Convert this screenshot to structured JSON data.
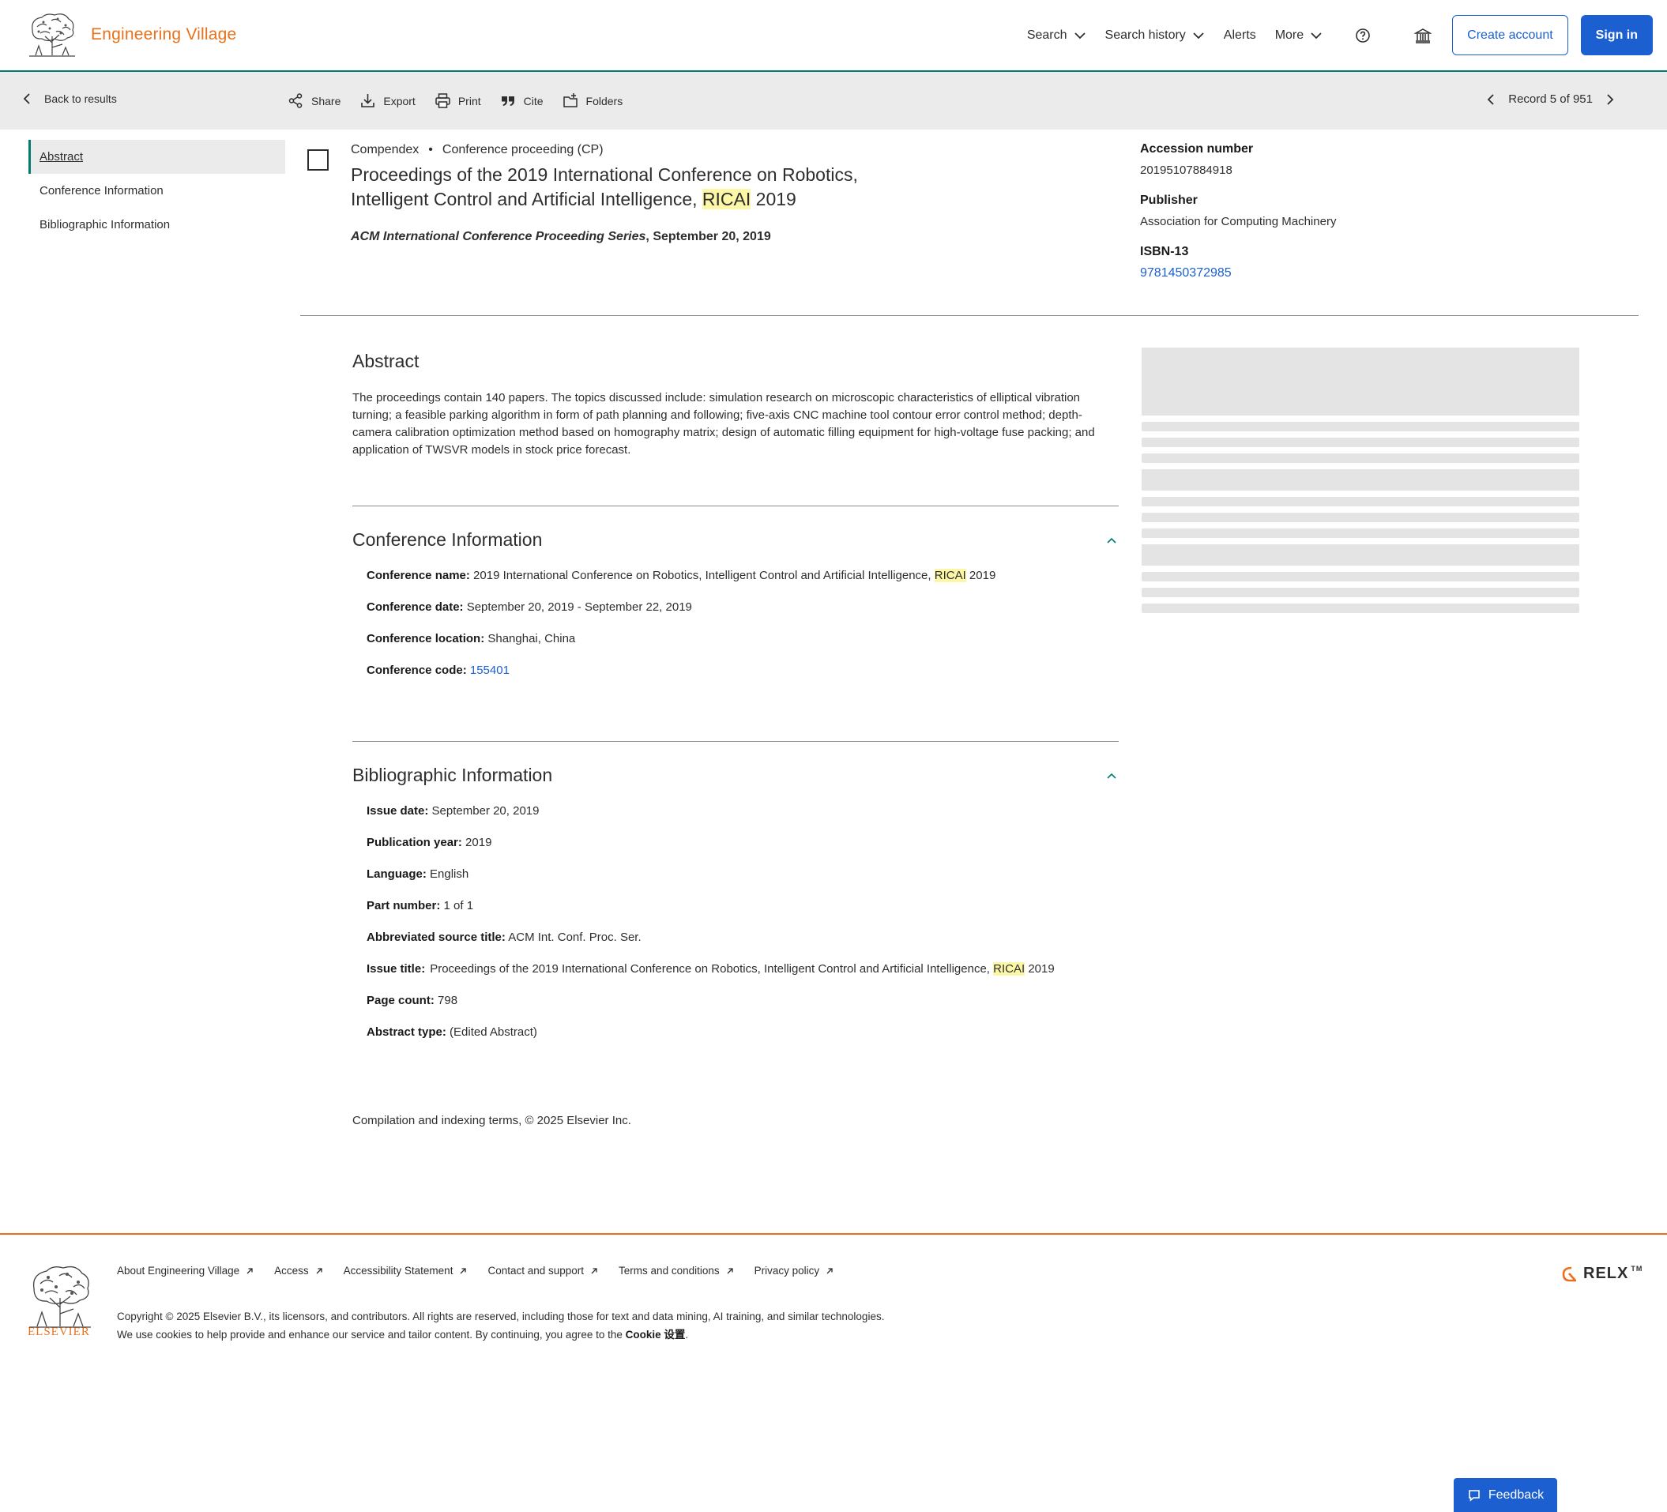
{
  "header": {
    "brand": "Engineering Village",
    "nav": {
      "search": "Search",
      "search_history": "Search history",
      "alerts": "Alerts",
      "more": "More"
    },
    "create_account": "Create account",
    "sign_in": "Sign in"
  },
  "toolbar": {
    "back": "Back to results",
    "share": "Share",
    "export": "Export",
    "print": "Print",
    "cite": "Cite",
    "folders": "Folders",
    "record": "Record 5 of 951"
  },
  "leftnav": {
    "items": [
      "Abstract",
      "Conference Information",
      "Bibliographic Information"
    ]
  },
  "record": {
    "database": "Compendex",
    "bullet": "•",
    "doc_type": "Conference proceeding (CP)",
    "title_part1": "Proceedings of the 2019 International Conference on Robotics, Intelligent Control and Artificial Intelligence, ",
    "title_highlight": "RICAI",
    "title_part2": " 2019",
    "source_series": "ACM International Conference Proceeding Series",
    "source_date": ", September 20, 2019"
  },
  "facts": {
    "accession_label": "Accession number",
    "accession_value": "20195107884918",
    "publisher_label": "Publisher",
    "publisher_value": "Association for Computing Machinery",
    "isbn_label": "ISBN-13",
    "isbn_value": "9781450372985"
  },
  "abstract": {
    "title": "Abstract",
    "text": "The proceedings contain 140 papers. The topics discussed include: simulation research on microscopic characteristics of elliptical vibration turning; a feasible parking algorithm in form of path planning and following; five-axis CNC machine tool contour error control method; depth-camera calibration optimization method based on homography matrix; design of automatic filling equipment for high-voltage fuse packing; and application of TWSVR models in stock price forecast."
  },
  "conference": {
    "title": "Conference Information",
    "name_label": "Conference name:",
    "name_value_part1": " 2019 International Conference on Robotics, Intelligent Control and Artificial Intelligence, ",
    "name_highlight": "RICAI",
    "name_value_part2": " 2019",
    "date_label": "Conference date:",
    "date_value": " September 20, 2019 - September 22, 2019",
    "location_label": "Conference location:",
    "location_value": " Shanghai, China",
    "code_label": "Conference code:",
    "code_value": "155401"
  },
  "biblio": {
    "title": "Bibliographic Information",
    "issue_date_label": "Issue date:",
    "issue_date_value": " September 20, 2019",
    "pub_year_label": "Publication year:",
    "pub_year_value": " 2019",
    "language_label": "Language:",
    "language_value": " English",
    "part_label": "Part number:",
    "part_value": " 1 of 1",
    "abbr_label": "Abbreviated source title:",
    "abbr_value": " ACM Int. Conf. Proc. Ser.",
    "issue_title_label": "Issue title:",
    "issue_title_part1": "Proceedings of the 2019 International Conference on Robotics, Intelligent Control and Artificial Intelligence, ",
    "issue_title_highlight": "RICAI",
    "issue_title_part2": " 2019",
    "page_count_label": "Page count:",
    "page_count_value": " 798",
    "abstract_type_label": "Abstract type:",
    "abstract_type_value": " (Edited Abstract)"
  },
  "compilation": "Compilation and indexing terms, © 2025 Elsevier Inc.",
  "footer": {
    "logo_text": "ELSEVIER",
    "links": [
      "About Engineering Village",
      "Access",
      "Accessibility Statement",
      "Contact and support",
      "Terms and conditions",
      "Privacy policy"
    ],
    "copyright": "Copyright © 2025 Elsevier B.V., its licensors, and contributors. All rights are reserved, including those for text and data mining, AI training, and similar technologies.",
    "cookie_text": "We use cookies to help provide and enhance our service and tailor content. By continuing, you agree to the ",
    "cookie_link": "Cookie 设置",
    "cookie_end": ".",
    "relx": "RELX",
    "relx_tm": "TM"
  },
  "feedback": "Feedback",
  "colors": {
    "brand_orange": "#e9711c",
    "teal_accent": "#007c70",
    "link_blue": "#1b5fd1",
    "highlight": "#fcf6a7"
  }
}
